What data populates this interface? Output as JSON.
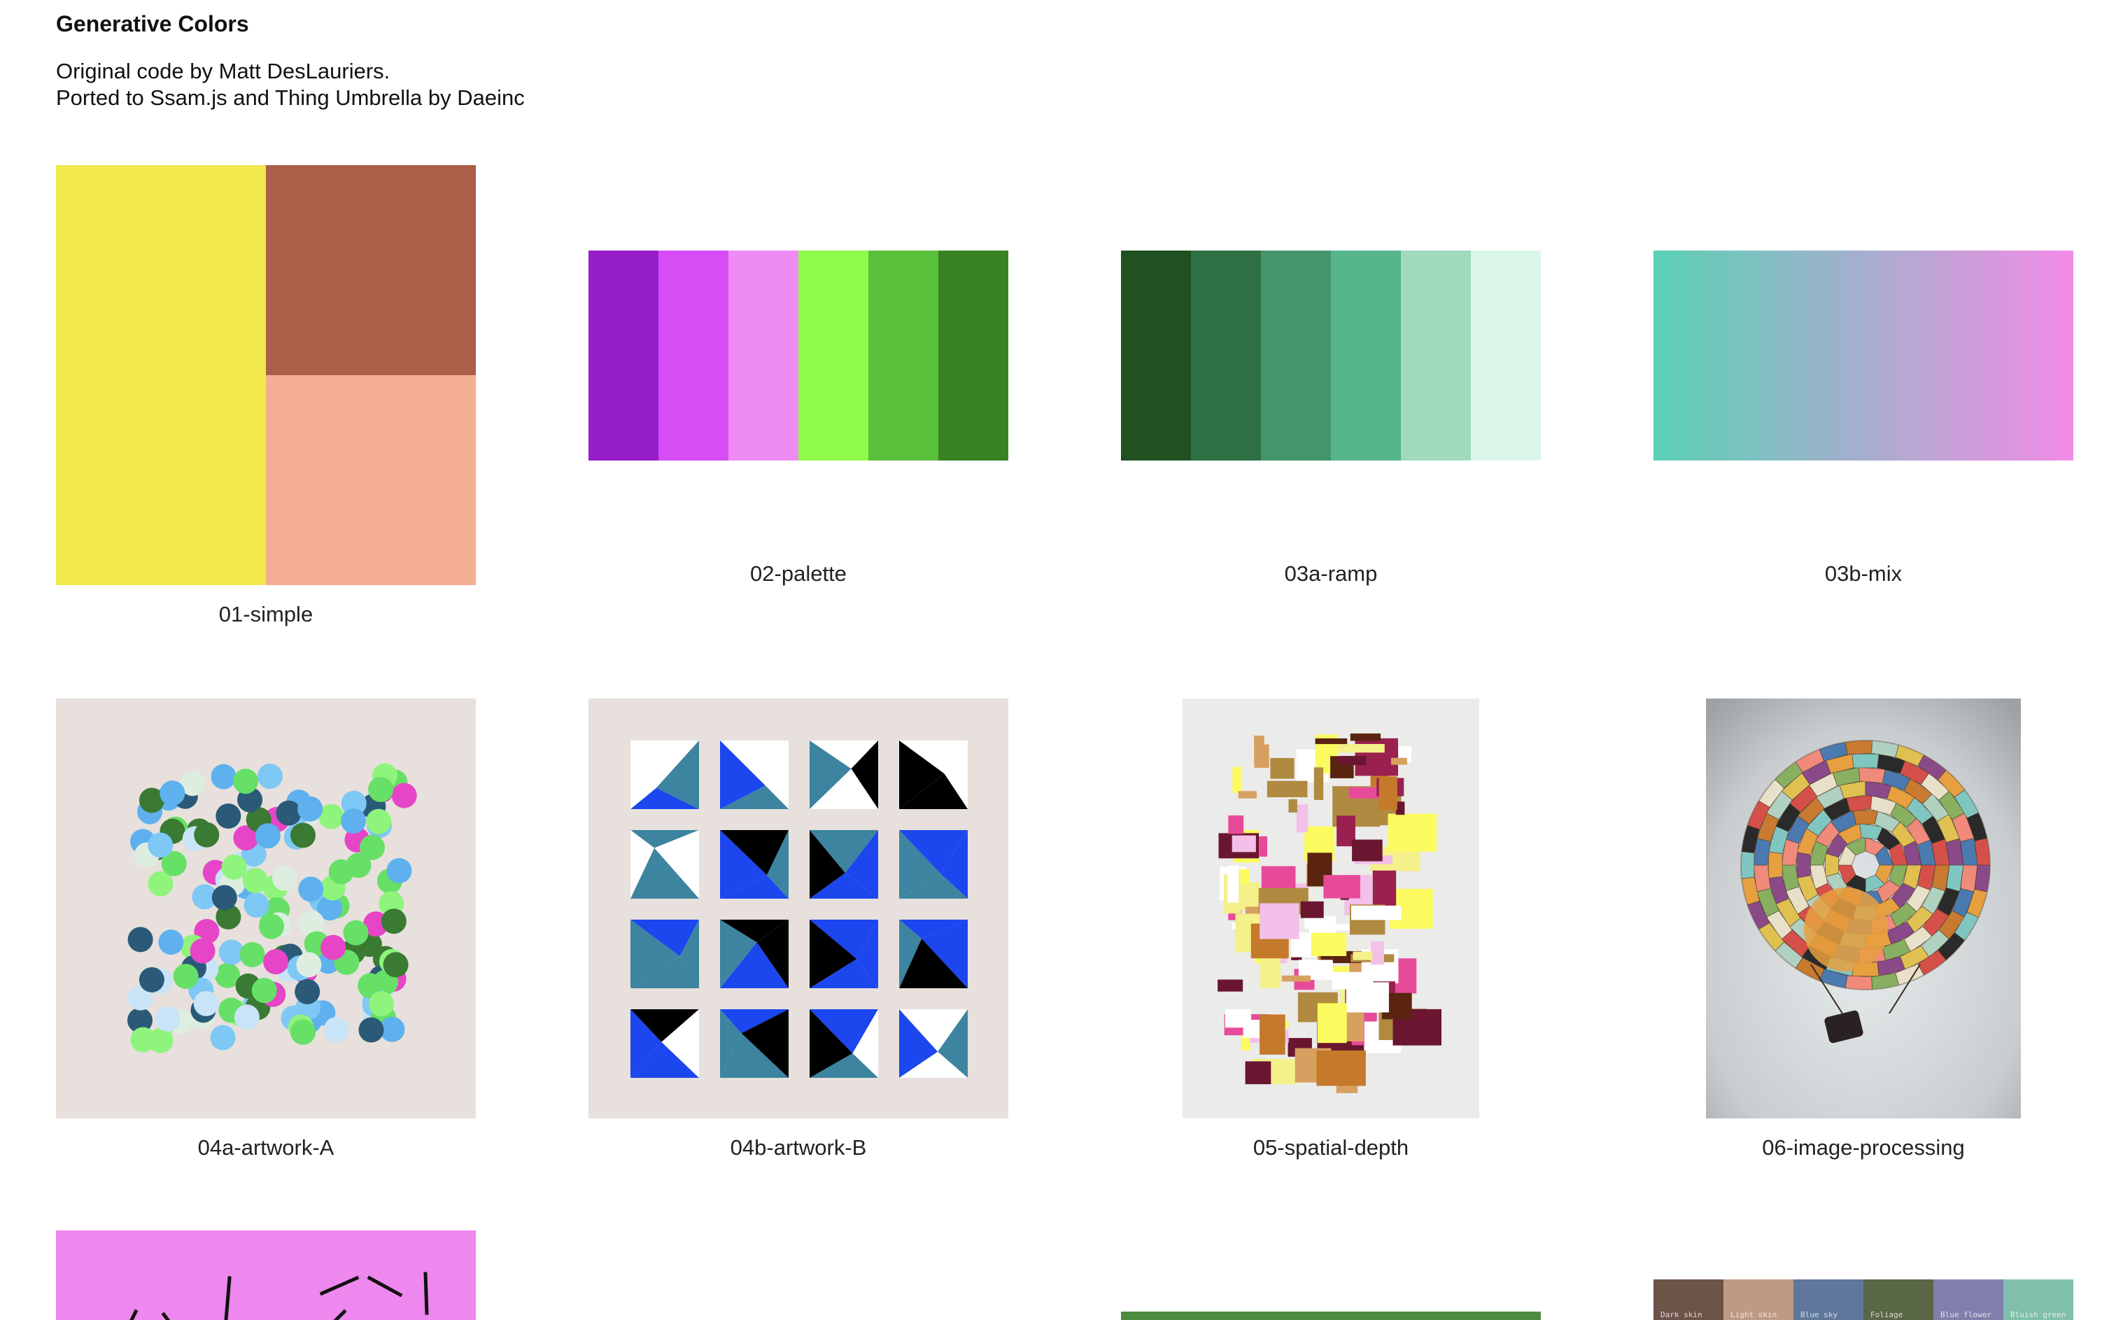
{
  "header": {
    "title": "Generative Colors",
    "credit_line_1": "Original code by Matt DesLauriers.",
    "credit_line_2": "Ported to Ssam.js and Thing Umbrella by Daeinc"
  },
  "gallery": [
    {
      "label": "01-simple"
    },
    {
      "label": "02-palette"
    },
    {
      "label": "03a-ramp"
    },
    {
      "label": "03b-mix"
    },
    {
      "label": "04a-artwork-A"
    },
    {
      "label": "04b-artwork-B"
    },
    {
      "label": "05-spatial-depth"
    },
    {
      "label": "06-image-processing"
    }
  ],
  "colors": {
    "simple": [
      "#f1e84d",
      "#aa5f48",
      "#f3ae94"
    ],
    "palette": [
      "#951dca",
      "#d64cf5",
      "#ef8bf4",
      "#8ffa4a",
      "#5ac03a",
      "#388222"
    ],
    "ramp": [
      "#215120",
      "#2e7043",
      "#43966a",
      "#55b68e",
      "#9fd9be",
      "#dbf7ea"
    ],
    "mix_start": "#5dcfb5",
    "mix_end": "#ef8de6",
    "artwork_bg": "#e7e0dc",
    "spatial_bg": "#ebebea",
    "pink_bg": "#ee88ee",
    "green_strip": "#4e8a3f",
    "checker": [
      "#6d5449",
      "#bd9a84",
      "#5e779b",
      "#5a6747",
      "#837fac",
      "#7fbfac"
    ]
  },
  "checker_labels": [
    "Dark skin",
    "Light skin",
    "Blue sky",
    "Foliage",
    "Blue flower",
    "Bluish green"
  ]
}
